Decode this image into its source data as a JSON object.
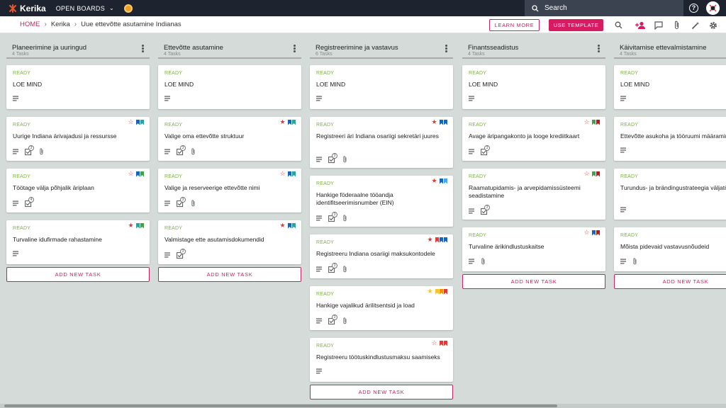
{
  "app": {
    "logo": "Kerika",
    "open_boards": "OPEN BOARDS"
  },
  "search": {
    "placeholder": "Search"
  },
  "breadcrumb": {
    "home": "HOME",
    "org": "Kerika",
    "board": "Uue ettevõtte asutamine Indianas"
  },
  "actions": {
    "learn_more": "LEARN MORE",
    "use_template": "USE TEMPLATE"
  },
  "colors": {
    "accent": "#d81b60",
    "ready": "#7cb342",
    "topbar": "#1d2430",
    "red": "#e53935",
    "blue": "#1565c0",
    "green": "#43a047",
    "teal": "#26a69a",
    "lightblue": "#42a5f5",
    "yellow": "#fbc02d",
    "orange": "#fb8c00",
    "brown": "#b71c1c"
  },
  "add_task_label": "ADD NEW TASK",
  "columns": [
    {
      "title": "Planeerimine ja uuringud",
      "count": "4 Tasks",
      "cards": [
        {
          "status": "READY",
          "title": "LOE MIND",
          "star": "",
          "flags": [],
          "checklist": "",
          "attach": false
        },
        {
          "status": "READY",
          "title": "Uurige Indiana ärivajadusi ja ressursse",
          "star": "outline",
          "flags": [
            "blue",
            "teal"
          ],
          "checklist": "3",
          "attach": true
        },
        {
          "status": "READY",
          "title": "Töötage välja põhjalik äriplaan",
          "star": "outline",
          "flags": [
            "blue",
            "green"
          ],
          "checklist": "4",
          "attach": false
        },
        {
          "status": "READY",
          "title": "Turvaline idufirmade rahastamine",
          "star": "filled",
          "flags": [
            "teal",
            "green"
          ],
          "checklist": "",
          "attach": false
        }
      ]
    },
    {
      "title": "Ettevõtte asutamine",
      "count": "4 Tasks",
      "cards": [
        {
          "status": "READY",
          "title": "LOE MIND",
          "star": "",
          "flags": [],
          "checklist": "",
          "attach": false
        },
        {
          "status": "READY",
          "title": "Valige oma ettevõtte struktuur",
          "star": "filled",
          "flags": [
            "blue",
            "teal"
          ],
          "checklist": "3",
          "attach": true
        },
        {
          "status": "READY",
          "title": "Valige ja reserveerige ettevõtte nimi",
          "star": "outline",
          "flags": [
            "blue",
            "teal"
          ],
          "checklist": "3",
          "attach": true
        },
        {
          "status": "READY",
          "title": "Valmistage ette asutamisdokumendid",
          "star": "filled",
          "flags": [
            "blue",
            "teal"
          ],
          "checklist": "3",
          "attach": false
        }
      ]
    },
    {
      "title": "Registreerimine ja vastavus",
      "count": "6 Tasks",
      "cards": [
        {
          "status": "READY",
          "title": "LOE MIND",
          "star": "",
          "flags": [],
          "checklist": "",
          "attach": false
        },
        {
          "status": "READY",
          "title": "Registreeri äri Indiana osariigi sekretäri juures",
          "star": "filled",
          "flags": [
            "blue",
            "blue"
          ],
          "checklist": "3",
          "attach": true
        },
        {
          "status": "READY",
          "title": "Hankige föderaalne tööandja identifitseerimisnumber (EIN)",
          "star": "filled",
          "flags": [
            "blue",
            "lightblue"
          ],
          "checklist": "3",
          "attach": true
        },
        {
          "status": "READY",
          "title": "Registreeru Indiana osariigi maksukontodele",
          "star": "filled",
          "flags": [
            "red",
            "blue",
            "blue"
          ],
          "checklist": "3",
          "attach": true
        },
        {
          "status": "READY",
          "title": "Hankige vajalikud ärilitsentsid ja load",
          "star": "filled-yellow",
          "flags": [
            "yellow",
            "orange",
            "red"
          ],
          "checklist": "3",
          "attach": true
        },
        {
          "status": "READY",
          "title": "Registreeru töötuskindlustusmaksu saamiseks",
          "star": "outline",
          "flags": [
            "red",
            "red"
          ],
          "checklist": "",
          "attach": false
        }
      ]
    },
    {
      "title": "Finantsseadistus",
      "count": "4 Tasks",
      "cards": [
        {
          "status": "READY",
          "title": "LOE MIND",
          "star": "",
          "flags": [],
          "checklist": "",
          "attach": false
        },
        {
          "status": "READY",
          "title": "Avage äripangakonto ja looge krediitkaart",
          "star": "outline",
          "flags": [
            "green",
            "brown"
          ],
          "checklist": "3",
          "attach": false
        },
        {
          "status": "READY",
          "title": "Raamatupidamis- ja arvepidamissüsteemi seadistamine",
          "star": "outline",
          "flags": [
            "green",
            "brown"
          ],
          "checklist": "3",
          "attach": false
        },
        {
          "status": "READY",
          "title": "Turvaline ärikindlustuskaitse",
          "star": "outline",
          "flags": [
            "blue",
            "brown"
          ],
          "checklist": "",
          "attach": true
        }
      ]
    },
    {
      "title": "Käivitamise ettevalmistamine",
      "count": "4 Tasks",
      "cards": [
        {
          "status": "READY",
          "title": "LOE MIND",
          "star": "",
          "flags": [],
          "checklist": "",
          "attach": false
        },
        {
          "status": "READY",
          "title": "Ettevõtte asukoha ja tööruumi määramine",
          "star": "",
          "flags": [],
          "checklist": "",
          "attach": false
        },
        {
          "status": "READY",
          "title": "Turundus- ja brändingustrateegia väljatöötamine",
          "star": "",
          "flags": [],
          "checklist": "",
          "attach": false
        },
        {
          "status": "READY",
          "title": "Mõista pidevaid vastavusnõudeid",
          "star": "",
          "flags": [],
          "checklist": "",
          "attach": true
        }
      ]
    }
  ]
}
